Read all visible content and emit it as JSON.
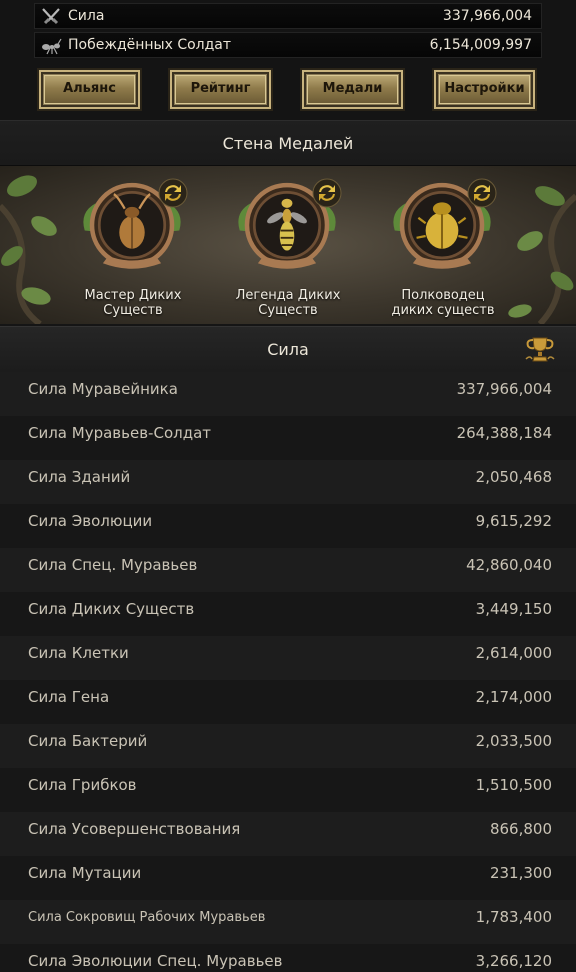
{
  "stats": {
    "power": {
      "label": "Сила",
      "value": "337,966,004",
      "icon": "crossed-swords-icon"
    },
    "defeated": {
      "label": "Побеждённых Солдат",
      "value": "6,154,009,997",
      "icon": "ant-soldier-icon"
    }
  },
  "buttons": {
    "alliance": "Альянс",
    "rating": "Рейтинг",
    "medals": "Медали",
    "settings": "Настройки"
  },
  "medal_wall": {
    "title": "Стена Медалей",
    "medals": [
      {
        "label_line1": "Мастер Диких",
        "label_line2": "Существ",
        "icon": "beetle-medal-icon"
      },
      {
        "label_line1": "Легенда Диких",
        "label_line2": "Существ",
        "icon": "wasp-medal-icon"
      },
      {
        "label_line1": "Полководец",
        "label_line2": "диких существ",
        "icon": "scarab-medal-icon"
      }
    ]
  },
  "power_section": {
    "title": "Сила",
    "rows": [
      {
        "label": "Сила Муравейника",
        "value": "337,966,004"
      },
      {
        "label": "Сила Муравьев-Солдат",
        "value": "264,388,184"
      },
      {
        "label": "Сила Зданий",
        "value": "2,050,468"
      },
      {
        "label": "Сила Эволюции",
        "value": "9,615,292"
      },
      {
        "label": "Сила Спец. Муравьев",
        "value": "42,860,040"
      },
      {
        "label": "Сила Диких Существ",
        "value": "3,449,150"
      },
      {
        "label": "Сила Клетки",
        "value": "2,614,000"
      },
      {
        "label": "Сила Гена",
        "value": "2,174,000"
      },
      {
        "label": "Сила Бактерий",
        "value": "2,033,500"
      },
      {
        "label": "Сила Грибков",
        "value": "1,510,500"
      },
      {
        "label": "Сила Усовершенствования",
        "value": "866,800"
      },
      {
        "label": "Сила Мутации",
        "value": "231,300"
      },
      {
        "label": "Сила Сокровищ Рабочих Муравьев",
        "value": "1,783,400"
      },
      {
        "label": "Сила Эволюции Спец. Муравьев",
        "value": "3,266,120"
      }
    ]
  }
}
